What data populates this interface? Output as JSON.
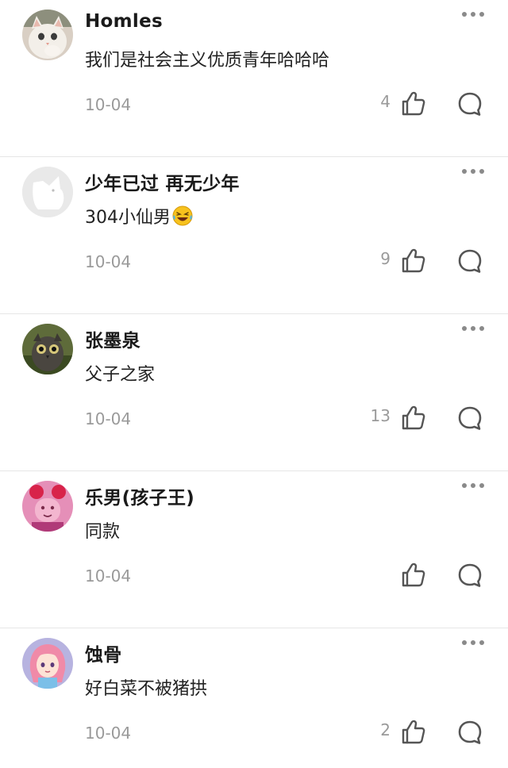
{
  "comments": [
    {
      "username": "Homles",
      "content": "我们是社会主义优质青年哈哈哈",
      "date": "10-04",
      "likes": "4",
      "emoji": ""
    },
    {
      "username": "少年已过 再无少年",
      "content": "304小仙男",
      "date": "10-04",
      "likes": "9",
      "emoji": "laughing-tears-emoji"
    },
    {
      "username": "张墨泉",
      "content": "父子之家",
      "date": "10-04",
      "likes": "13",
      "emoji": ""
    },
    {
      "username": "乐男(孩子王)",
      "content": "同款",
      "date": "10-04",
      "likes": "",
      "emoji": ""
    },
    {
      "username": "蚀骨",
      "content": "好白菜不被猪拱",
      "date": "10-04",
      "likes": "2",
      "emoji": ""
    }
  ],
  "icons": {
    "more": "more-dots-icon",
    "like": "thumbs-up-icon",
    "reply": "comment-bubble-icon"
  },
  "colors": {
    "text_primary": "#1a1a1a",
    "text_secondary": "#9a9a9a",
    "icon": "#555555",
    "divider": "#e6e6e6"
  }
}
